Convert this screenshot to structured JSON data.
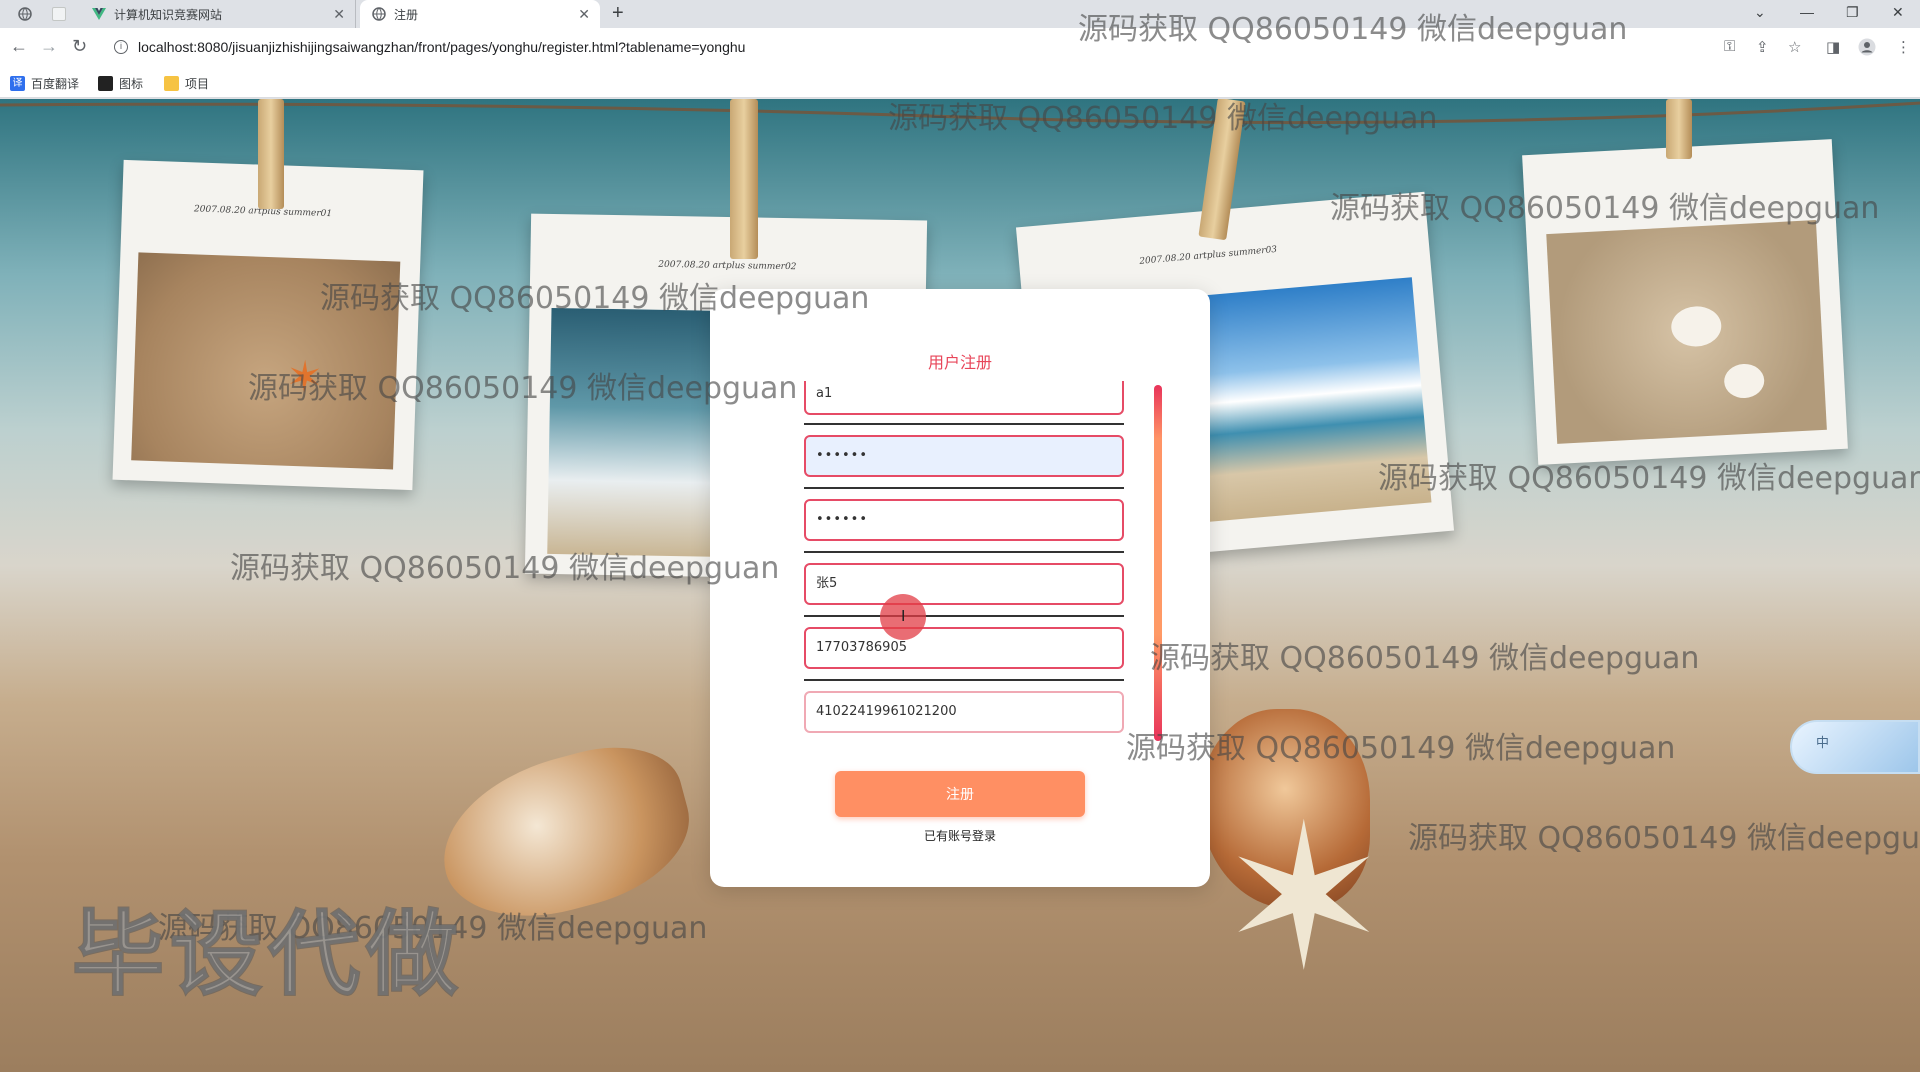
{
  "browser": {
    "tabs": [
      {
        "label": ""
      },
      {
        "label": ""
      },
      {
        "label": "计算机知识竞赛网站"
      },
      {
        "label": "注册"
      }
    ],
    "url": "localhost:8080/jisuanjizhishijingsaiwangzhan/front/pages/yonghu/register.html?tablename=yonghu",
    "bookmarks": [
      {
        "label": "百度翻译"
      },
      {
        "label": "图标"
      },
      {
        "label": "项目"
      }
    ]
  },
  "background": {
    "photo_captions": [
      "2007.08.20 artplus summer01",
      "2007.08.20 artplus summer02",
      "2007.08.20 artplus summer03"
    ]
  },
  "form": {
    "title": "用户注册",
    "fields": [
      {
        "value": "a1"
      },
      {
        "value": "••••••"
      },
      {
        "value": "••••••"
      },
      {
        "value": "张5"
      },
      {
        "value": "17703786905"
      },
      {
        "value": "41022419961021200"
      }
    ],
    "submit_label": "注册",
    "login_link": "已有账号登录"
  },
  "overlay": {
    "watermark": "源码获取 QQ86050149 微信deepguan",
    "watermark_cut": "源码获取 QQ86050149 微信deepgua",
    "stamp": "毕设代做",
    "ime_label": "中"
  },
  "colors": {
    "accent": "#e64b66",
    "button": "#ff8f63",
    "title": "#e8465a"
  }
}
